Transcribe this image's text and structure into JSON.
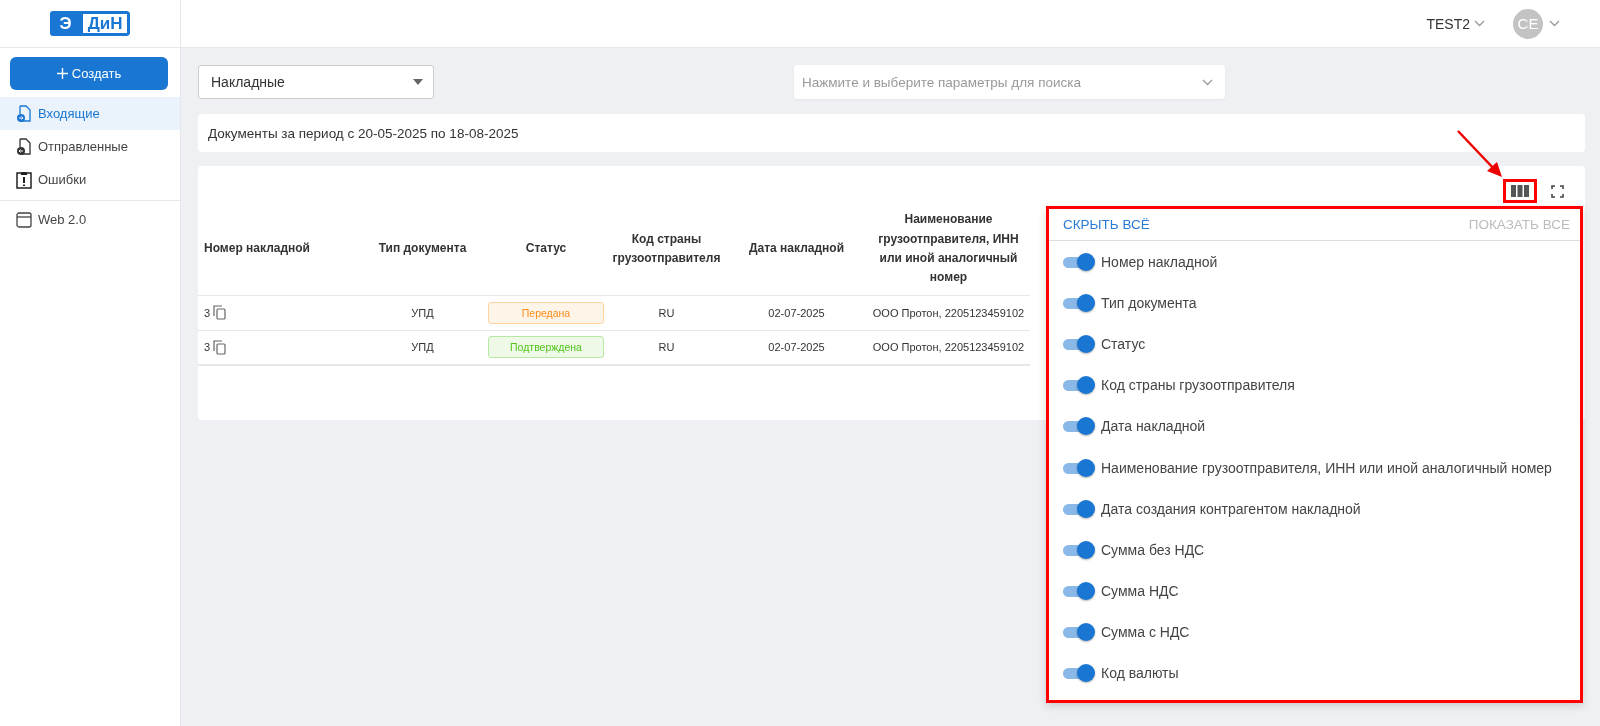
{
  "header": {
    "logo": {
      "left": "Э",
      "right": "ДиН"
    },
    "org": "TEST2",
    "avatar": "CE"
  },
  "sidebar": {
    "create_button": "Создать",
    "items": [
      {
        "label": "Входящие",
        "selected": true
      },
      {
        "label": "Отправленные",
        "selected": false
      },
      {
        "label": "Ошибки",
        "selected": false
      }
    ],
    "extra_items": [
      {
        "label": "Web 2.0",
        "selected": false
      }
    ]
  },
  "doc_type_select": {
    "value": "Накладные"
  },
  "search": {
    "placeholder": "Нажмите и выберите параметры для поиска"
  },
  "period": "Документы за период с 20-05-2025 по 18-08-2025",
  "table": {
    "columns": [
      "Номер накладной",
      "Тип документа",
      "Статус",
      "Код страны грузоотправителя",
      "Дата накладной",
      "Наименование грузоотправителя, ИНН или иной аналогичный номер"
    ],
    "rows": [
      {
        "number": "3",
        "type": "УПД",
        "status": {
          "label": "Передана",
          "color": "#fa8c16"
        },
        "country": "RU",
        "date": "02-07-2025",
        "shipper": "ООО Протон, 2205123459102"
      },
      {
        "number": "3",
        "type": "УПД",
        "status": {
          "label": "Подтверждена",
          "color": "#52c41a"
        },
        "country": "RU",
        "date": "02-07-2025",
        "shipper": "ООО Протон, 2205123459102"
      }
    ]
  },
  "column_menu": {
    "hide_all": "СКРЫТЬ ВСЁ",
    "show_all": {
      "label": "ПОКАЗАТЬ ВСЕ",
      "disabled": true
    },
    "columns": [
      {
        "label": "Номер накладной",
        "on": true
      },
      {
        "label": "Тип документа",
        "on": true
      },
      {
        "label": "Статус",
        "on": true
      },
      {
        "label": "Код страны грузоотправителя",
        "on": true
      },
      {
        "label": "Дата накладной",
        "on": true
      },
      {
        "label": "Наименование грузоотправителя, ИНН или иной аналогичный номер",
        "on": true
      },
      {
        "label": "Дата создания контрагентом накладной",
        "on": true
      },
      {
        "label": "Сумма без НДС",
        "on": true
      },
      {
        "label": "Сумма НДС",
        "on": true
      },
      {
        "label": "Сумма с НДС",
        "on": true
      },
      {
        "label": "Код валюты",
        "on": true
      }
    ]
  }
}
